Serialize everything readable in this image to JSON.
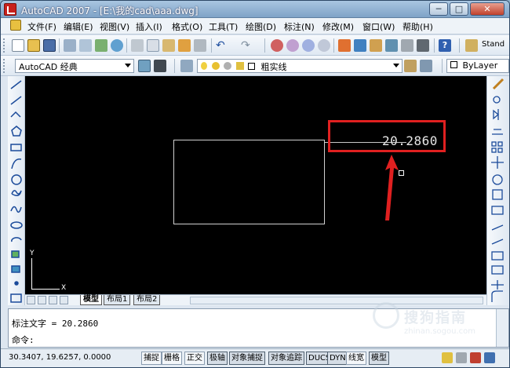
{
  "window": {
    "title": "AutoCAD 2007 - [E:\\我的cad\\aaa.dwg]",
    "min": "0",
    "max": "1",
    "close": "r"
  },
  "menu": [
    "文件(F)",
    "编辑(E)",
    "视图(V)",
    "插入(I)",
    "格式(O)",
    "工具(T)",
    "绘图(D)",
    "标注(N)",
    "修改(M)",
    "窗口(W)",
    "帮助(H)"
  ],
  "toolbar": {
    "workspace": "AutoCAD 经典",
    "layer": "粗实线",
    "bylayer": "ByLayer",
    "standard": "Stand"
  },
  "canvas": {
    "dimension": "20.2860",
    "axis_x": "X",
    "axis_y": "Y"
  },
  "tabs": {
    "items": [
      "模型",
      "布局1",
      "布局2"
    ],
    "active": "模型"
  },
  "command": {
    "line1": "标注文字 = 20.2860",
    "line2": "命令:"
  },
  "status": {
    "coords": "30.3407, 19.6257, 0.0000",
    "buttons": [
      "捕捉",
      "栅格",
      "正交",
      "极轴",
      "对象捕捉",
      "对象追踪",
      "DUCS",
      "DYN",
      "线宽",
      "模型"
    ]
  },
  "watermark": {
    "text": "搜狗指南",
    "url": "zhinan.sogou.com"
  },
  "colors": {
    "canvas": "#000000",
    "highlight": "#e02020",
    "arrow": "#e02020"
  }
}
